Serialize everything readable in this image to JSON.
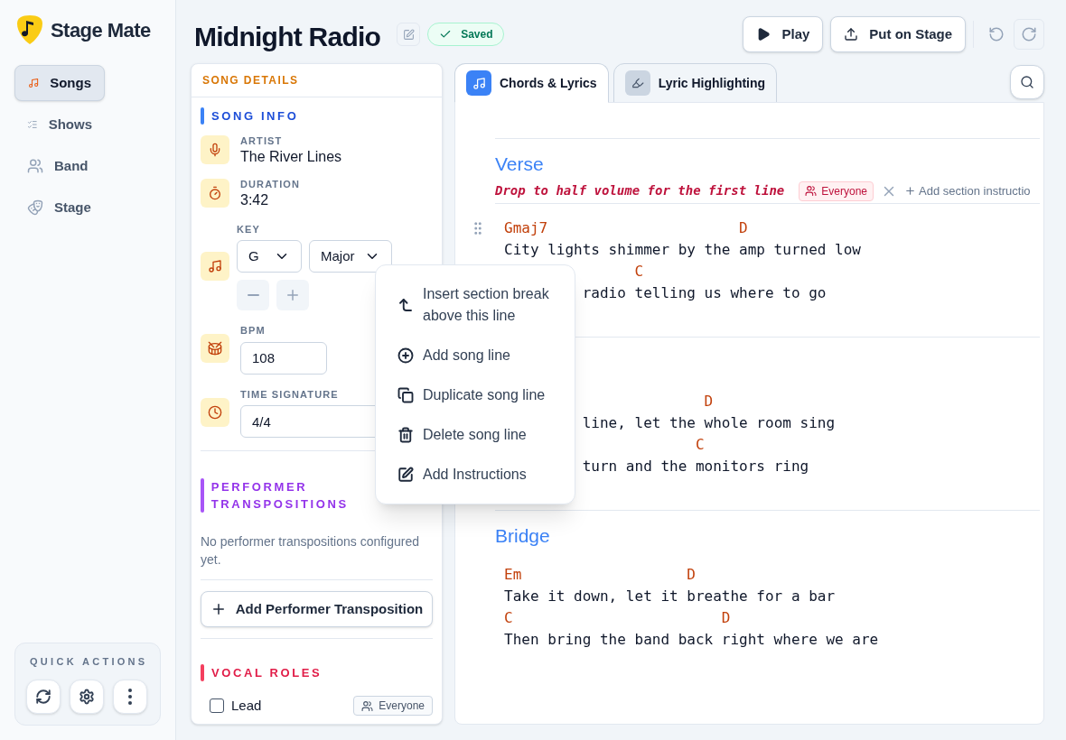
{
  "app": {
    "name": "Stage Mate"
  },
  "nav": [
    {
      "label": "Songs",
      "selected": true
    },
    {
      "label": "Shows",
      "selected": false
    },
    {
      "label": "Band",
      "selected": false
    },
    {
      "label": "Stage",
      "selected": false
    }
  ],
  "quick_actions": {
    "title": "QUICK ACTIONS"
  },
  "header": {
    "title": "Midnight Radio",
    "status": "Saved",
    "actions": [
      "Play",
      "Put on Stage"
    ]
  },
  "details": {
    "title": "SONG DETAILS",
    "song_info": {
      "title": "SONG INFO",
      "fields": [
        {
          "kind": "text",
          "label": "ARTIST",
          "value": "The River Lines"
        },
        {
          "kind": "text",
          "label": "DURATION",
          "value": "3:42"
        },
        {
          "kind": "key",
          "label": "KEY",
          "note": "G",
          "mode": "Major"
        },
        {
          "kind": "input",
          "label": "BPM",
          "value": "108"
        },
        {
          "kind": "input",
          "label": "TIME SIGNATURE",
          "value": "4/4"
        }
      ]
    },
    "transpositions": {
      "title": "PERFORMER TRANSPOSITIONS",
      "empty": "No performer transpositions configured yet.",
      "button": "Add Performer Transposition"
    },
    "vocal_roles": {
      "title": "VOCAL ROLES",
      "roles": [
        {
          "name": "Lead",
          "checked": false,
          "assignee": "Everyone"
        }
      ]
    }
  },
  "tabs": [
    {
      "label": "Chords & Lyrics",
      "selected": true
    },
    {
      "label": "Lyric Highlighting",
      "selected": false
    }
  ],
  "sections": [
    {
      "name": "Verse",
      "instruction": {
        "text": "Drop to half volume for the first line",
        "audience": "Everyone"
      },
      "add_instruction": "Add section instructio",
      "lines": [
        {
          "kind": "chord",
          "text": "Gmaj7                      D"
        },
        {
          "kind": "lyric",
          "text": "City lights shimmer by the amp turned low"
        },
        {
          "kind": "chord",
          "text": "               C"
        },
        {
          "kind": "lyric",
          "text": "         radio telling us where to go"
        }
      ]
    },
    {
      "lines": [
        {
          "kind": "chord",
          "text": "                       D"
        },
        {
          "kind": "lyric",
          "text": "         line, let the whole room sing"
        },
        {
          "kind": "chord",
          "text": "                      C"
        },
        {
          "kind": "lyric",
          "text": "         turn and the monitors ring"
        }
      ]
    },
    {
      "name": "Bridge",
      "lines": [
        {
          "kind": "chord",
          "text": "Em                   D"
        },
        {
          "kind": "lyric",
          "text": "Take it down, let it breathe for a bar"
        },
        {
          "kind": "chord",
          "text": "C                        D"
        },
        {
          "kind": "lyric",
          "text": "Then bring the band back right where we are"
        }
      ]
    }
  ],
  "context_menu": [
    {
      "kind": "section_break",
      "label": "Insert section break above this line"
    },
    {
      "kind": "add",
      "label": "Add song line"
    },
    {
      "kind": "duplicate",
      "label": "Duplicate song line"
    },
    {
      "kind": "delete",
      "label": "Delete song line"
    },
    {
      "kind": "instructions",
      "label": "Add Instructions"
    }
  ]
}
